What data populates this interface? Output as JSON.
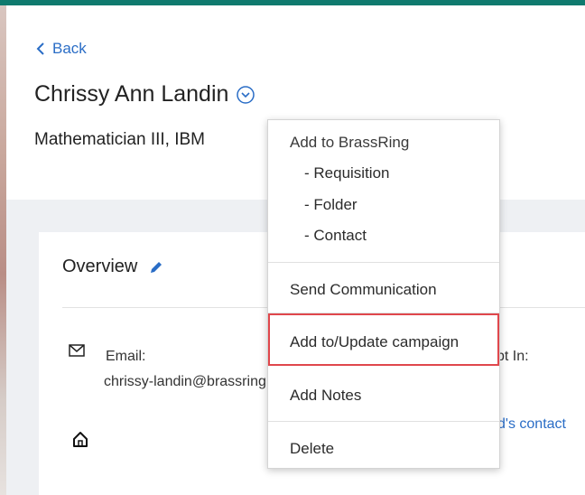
{
  "header": {
    "back_label": "Back",
    "candidate_name": "Chrissy Ann Landin",
    "subtitle": "Mathematician III, IBM"
  },
  "overview": {
    "title": "Overview",
    "email_label": "Email:",
    "email_value": "chrissy-landin@brassring.com",
    "opt_in_fragment": "pt In:",
    "contact_link_fragment": "d's contact"
  },
  "actions_menu": {
    "add_to_header": "Add to BrassRing",
    "requisition": "- Requisition",
    "folder": "- Folder",
    "contact": "- Contact",
    "send_communication": "Send Communication",
    "add_update_campaign": "Add to/Update campaign",
    "add_notes": "Add Notes",
    "delete": "Delete"
  },
  "colors": {
    "accent_top_bar": "#0f7a6e",
    "link_blue": "#2a6dc6",
    "highlight_red": "#e0474c"
  },
  "icons": {
    "back": "chevron-left-icon",
    "toggle": "chevron-down-circle-icon",
    "edit": "pencil-icon",
    "email": "envelope-icon",
    "address": "home-icon"
  }
}
